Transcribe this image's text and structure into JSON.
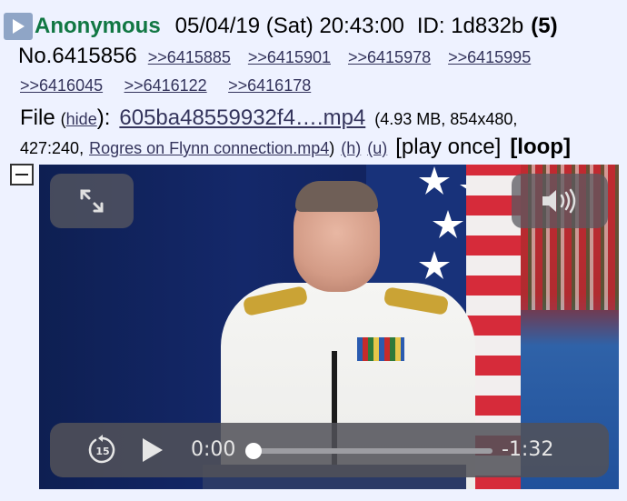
{
  "post": {
    "name": "Anonymous",
    "date": "05/04/19 (Sat) 20:43:00",
    "id_label": "ID: 1d832b",
    "count": "(5)",
    "post_number": "No.6415856",
    "backlinks": [
      ">>6415885",
      ">>6415901",
      ">>6415978",
      ">>6415995",
      ">>6416045",
      ">>6416122",
      ">>6416178"
    ]
  },
  "file": {
    "label": "File",
    "hide_open": "(",
    "hide": "hide",
    "hide_close": "):",
    "filename": "605ba48559932f4….mp4",
    "meta_part1": "(4.93 MB, 854x480,",
    "meta_part2": "427:240,",
    "original_name": "Rogres on Flynn connection.mp4",
    "close_paren": ")",
    "h_link": "(h)",
    "u_link": "(u)",
    "play_once": "[play once]",
    "loop": "[loop]"
  },
  "player": {
    "current_time": "0:00",
    "remaining_time": "-1:32",
    "skip_seconds": "15",
    "progress": 0.0
  },
  "colors": {
    "background": "#eef2ff",
    "name": "#117743",
    "link": "#34345c"
  },
  "icons": [
    "play-icon",
    "collapse-icon",
    "expand-icon",
    "volume-icon",
    "skip-back-15-icon",
    "play-icon"
  ]
}
